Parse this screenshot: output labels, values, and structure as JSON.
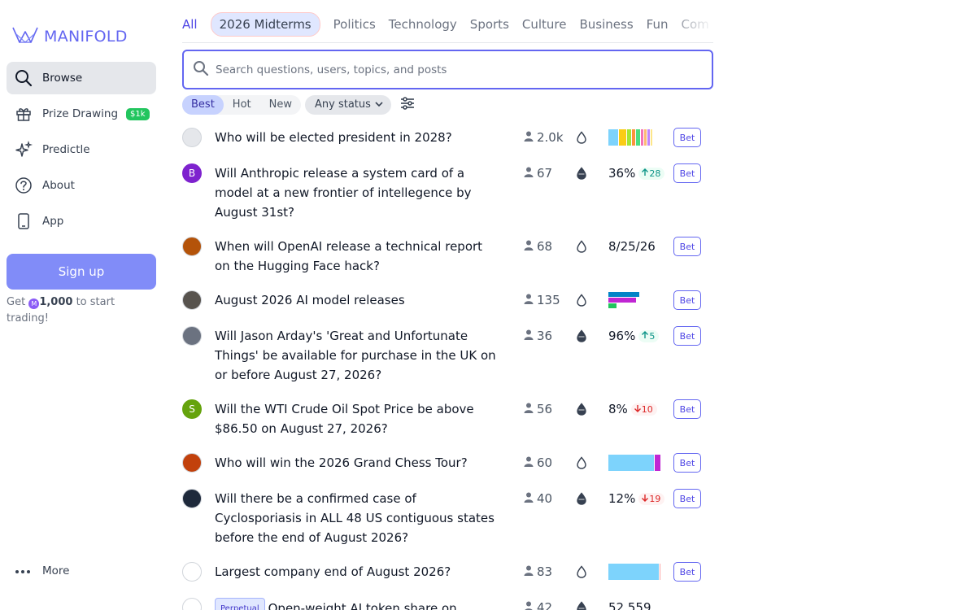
{
  "app": {
    "logo_text": "MANIFOLD"
  },
  "sidebar": {
    "items": [
      {
        "label": "Browse",
        "icon": "search-icon",
        "active": true
      },
      {
        "label": "Prize Drawing",
        "icon": "gift-icon",
        "badge": "$1k"
      },
      {
        "label": "Predictle",
        "icon": "sparkles-icon"
      },
      {
        "label": "About",
        "icon": "question-circle-icon"
      },
      {
        "label": "App",
        "icon": "phone-icon"
      }
    ],
    "signup_label": "Sign up",
    "signup_note_prefix": "Get",
    "signup_note_amount": "1,000",
    "signup_note_suffix": "to start trading!",
    "more_label": "More"
  },
  "topics": [
    "All",
    "2026 Midterms",
    "Politics",
    "Technology",
    "Sports",
    "Culture",
    "Business",
    "Fun",
    "Com"
  ],
  "search": {
    "placeholder": "Search questions, users, topics, and posts",
    "value": ""
  },
  "filters": {
    "sort_options": [
      "Best",
      "Hot",
      "New"
    ],
    "selected_sort": "Best",
    "status_label": "Any status"
  },
  "colors": {
    "accent": "#6366f1",
    "up": "#0d9488",
    "down": "#dc2626"
  },
  "markets": [
    {
      "question": "Who will be elected president in 2028?",
      "traders": "2.0k",
      "prob": "",
      "type": "multi",
      "bars": [
        {
          "c": "#7dd3fc",
          "w": 0.2
        },
        {
          "c": "#facc15",
          "w": 0.15
        },
        {
          "c": "#a3e635",
          "w": 0.1
        },
        {
          "c": "#fb923c",
          "w": 0.08
        },
        {
          "c": "#4ade80",
          "w": 0.08
        },
        {
          "c": "#f472b6",
          "w": 0.07
        },
        {
          "c": "#fdba74",
          "w": 0.06
        },
        {
          "c": "#c084fc",
          "w": 0.06
        },
        {
          "c": "#fde68a",
          "w": 0.05
        }
      ],
      "bet_label": "Bet",
      "avatar_letter": "",
      "avatar_color": "#e5e7eb"
    },
    {
      "question": "Will Anthropic release a system card of a model at a new frontier of intellegence by August 31st?",
      "traders": "67",
      "prob": "36%",
      "change": "28",
      "direction": "up",
      "type": "binary",
      "bet_label": "Bet",
      "avatar_letter": "B",
      "avatar_color": "#7e22ce"
    },
    {
      "question": "When will OpenAI release a technical report on the Hugging Face hack?",
      "traders": "68",
      "prob": "8/25/26",
      "type": "date",
      "bet_label": "Bet",
      "avatar_letter": "",
      "avatar_color": "#b45309"
    },
    {
      "question": "August 2026 AI model releases",
      "traders": "135",
      "prob": "",
      "type": "stacked",
      "bet_label": "Bet",
      "avatar_letter": "",
      "avatar_color": "#57534e"
    },
    {
      "question": "Will Jason Arday's 'Great and Unfortunate Things' be available for purchase in the UK on or before August 27, 2026?",
      "traders": "36",
      "prob": "96%",
      "change": "5",
      "direction": "up",
      "type": "binary",
      "bet_label": "Bet",
      "avatar_letter": "",
      "avatar_color": "#6b7280"
    },
    {
      "question": "Will the WTI Crude Oil Spot Price be above $86.50 on August 27, 2026?",
      "traders": "56",
      "prob": "8%",
      "change": "10",
      "direction": "down",
      "type": "binary",
      "bet_label": "Bet",
      "avatar_letter": "S",
      "avatar_color": "#65a30d"
    },
    {
      "question": "Who will win the 2026 Grand Chess Tour?",
      "traders": "60",
      "prob": "",
      "type": "multi",
      "bars": [
        {
          "c": "#7dd3fc",
          "w": 0.88
        },
        {
          "c": "#c026d3",
          "w": 0.12
        }
      ],
      "bet_label": "Bet",
      "avatar_letter": "",
      "avatar_color": "#c2410c"
    },
    {
      "question": "Will there be a confirmed case of Cyclosporiasis in ALL 48 US contiguous states before the end of August 2026?",
      "traders": "40",
      "prob": "12%",
      "change": "19",
      "direction": "down",
      "type": "binary",
      "bet_label": "Bet",
      "avatar_letter": "",
      "avatar_color": "#1e293b"
    },
    {
      "question": "Largest company end of August 2026?",
      "traders": "83",
      "prob": "",
      "type": "multi",
      "bars": [
        {
          "c": "#7dd3fc",
          "w": 0.97
        },
        {
          "c": "#fca5a5",
          "w": 0.03
        }
      ],
      "bet_label": "Bet",
      "avatar_letter": "",
      "avatar_color": "#ffffff"
    },
    {
      "question": "Open-weight AI token share on",
      "tag": "Perpetual",
      "traders": "42",
      "prob": "52,559",
      "type": "number",
      "bet_label": "",
      "avatar_letter": "",
      "avatar_color": "#ffffff"
    }
  ]
}
